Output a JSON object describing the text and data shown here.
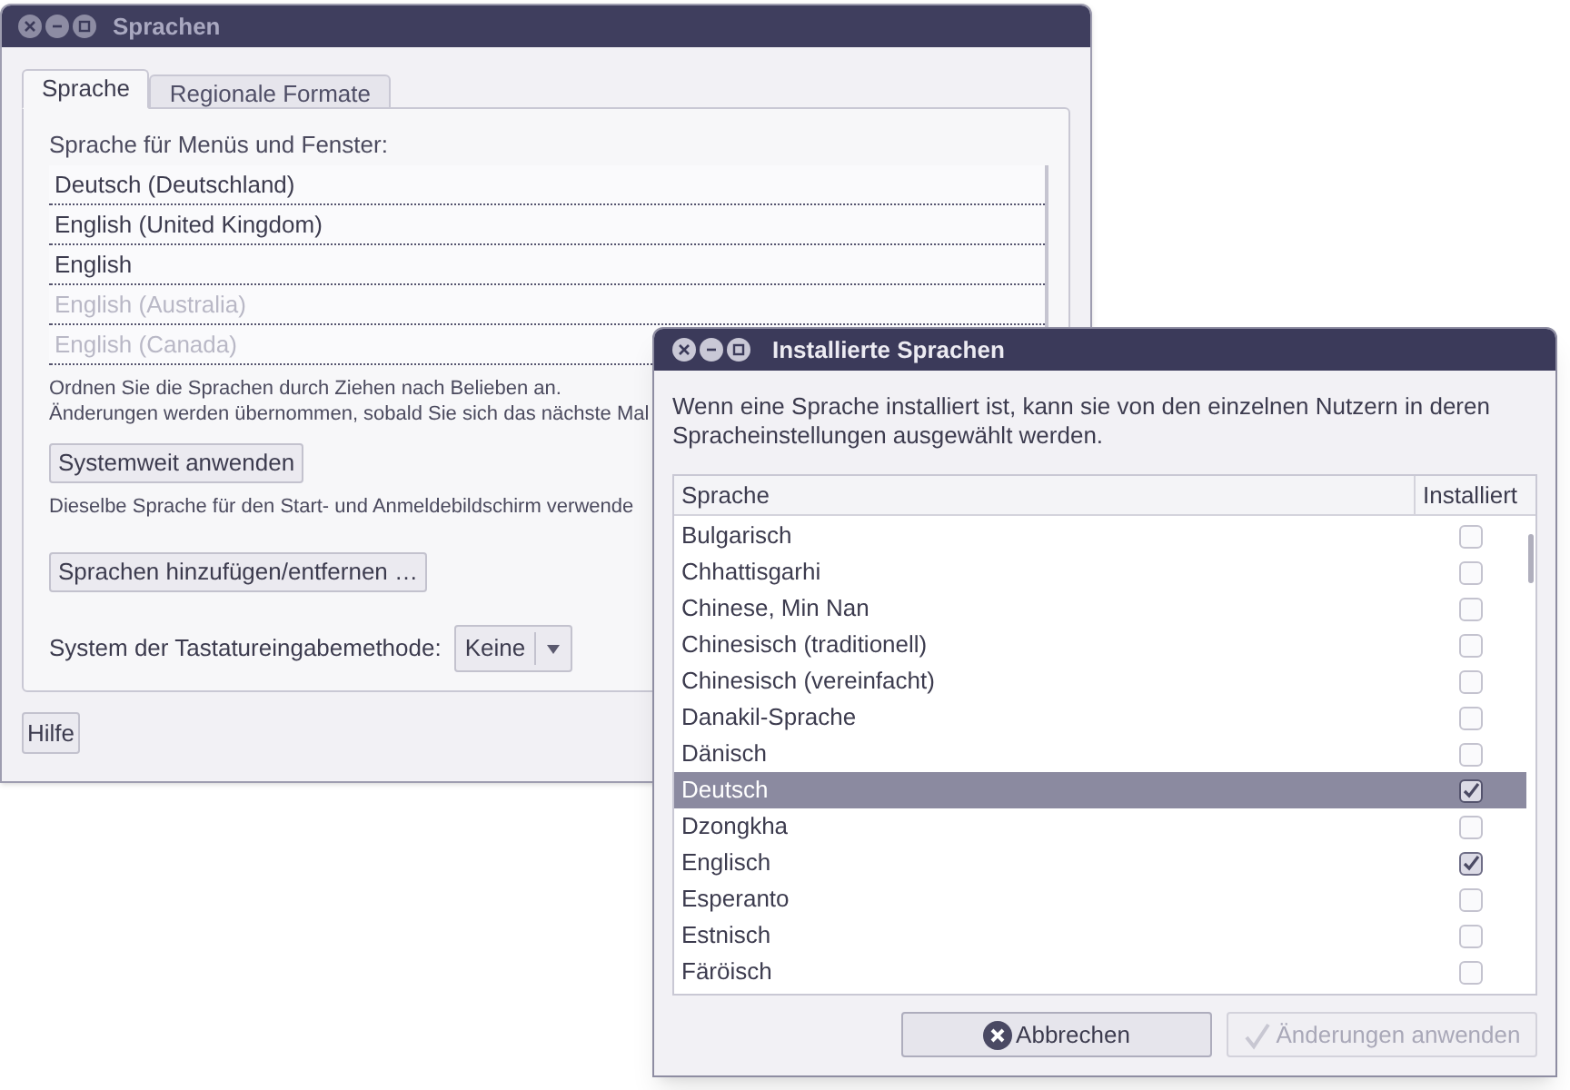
{
  "main_window": {
    "title": "Sprachen",
    "tabs": [
      {
        "label": "Sprache",
        "selected": true
      },
      {
        "label": "Regionale Formate",
        "selected": false
      }
    ],
    "list_label": "Sprache für Menüs und Fenster:",
    "languages": [
      {
        "name": "Deutsch (Deutschland)",
        "disabled": false
      },
      {
        "name": "English (United Kingdom)",
        "disabled": false
      },
      {
        "name": "English",
        "disabled": false
      },
      {
        "name": "English (Australia)",
        "disabled": true
      },
      {
        "name": "English (Canada)",
        "disabled": true
      }
    ],
    "hint_lines": [
      "Ordnen Sie die Sprachen durch Ziehen nach Belieben an.",
      "Änderungen werden übernommen, sobald Sie sich das nächste Mal"
    ],
    "apply_button": "Systemweit anwenden",
    "apply_hint": "Dieselbe Sprache für den Start- und Anmeldebildschirm verwende",
    "add_button": "Sprachen hinzufügen/entfernen …",
    "input_method": {
      "label": "System der Tastatureingabemethode:",
      "value": "Keine"
    },
    "help_button": "Hilfe"
  },
  "dialog": {
    "title": "Installierte Sprachen",
    "description": "Wenn eine Sprache installiert ist, kann sie von den einzelnen Nutzern in deren Spracheinstellungen ausgewählt werden.",
    "columns": [
      "Sprache",
      "Installiert"
    ],
    "rows": [
      {
        "name": "Bulgarisch",
        "installed": false,
        "selected": false
      },
      {
        "name": "Chhattisgarhi",
        "installed": false,
        "selected": false
      },
      {
        "name": "Chinese, Min Nan",
        "installed": false,
        "selected": false
      },
      {
        "name": "Chinesisch (traditionell)",
        "installed": false,
        "selected": false
      },
      {
        "name": "Chinesisch (vereinfacht)",
        "installed": false,
        "selected": false
      },
      {
        "name": "Danakil-Sprache",
        "installed": false,
        "selected": false
      },
      {
        "name": "Dänisch",
        "installed": false,
        "selected": false
      },
      {
        "name": "Deutsch",
        "installed": true,
        "selected": true
      },
      {
        "name": "Dzongkha",
        "installed": false,
        "selected": false
      },
      {
        "name": "Englisch",
        "installed": true,
        "selected": false
      },
      {
        "name": "Esperanto",
        "installed": false,
        "selected": false
      },
      {
        "name": "Estnisch",
        "installed": false,
        "selected": false
      },
      {
        "name": "Färöisch",
        "installed": false,
        "selected": false
      }
    ],
    "buttons": [
      {
        "label": "Abbrechen",
        "kind": "cancel",
        "disabled": false
      },
      {
        "label": "Änderungen anwenden",
        "kind": "apply",
        "disabled": true
      }
    ]
  }
}
